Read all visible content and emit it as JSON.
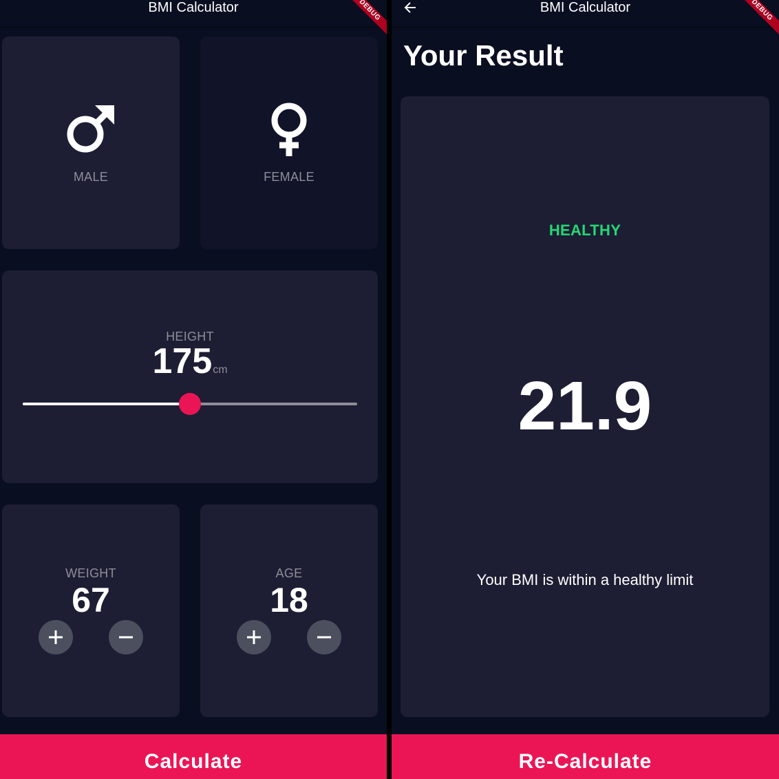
{
  "colors": {
    "background": "#0a0e21",
    "card_active": "#1d1e33",
    "card_inactive": "#111328",
    "label": "#8d8e98",
    "accent": "#eb1555",
    "round_button": "#4c4f5e",
    "healthy": "#24d876"
  },
  "input_screen": {
    "appbar": {
      "title": "BMI Calculator",
      "debug_banner": "DEBUG"
    },
    "gender": {
      "male": {
        "label": "MALE",
        "icon": "male-symbol-icon",
        "selected": true
      },
      "female": {
        "label": "FEMALE",
        "icon": "female-symbol-icon",
        "selected": false
      }
    },
    "height": {
      "label": "HEIGHT",
      "value": "175",
      "unit": "cm",
      "slider_fraction": 0.5
    },
    "weight": {
      "label": "WEIGHT",
      "value": "67",
      "increment_icon": "plus-icon",
      "decrement_icon": "minus-icon"
    },
    "age": {
      "label": "AGE",
      "value": "18",
      "increment_icon": "plus-icon",
      "decrement_icon": "minus-icon"
    },
    "bottom_button": {
      "label": "Calculate"
    }
  },
  "result_screen": {
    "appbar": {
      "title": "BMI Calculator",
      "debug_banner": "DEBUG",
      "back_icon": "arrow-back-icon"
    },
    "title": "Your Result",
    "status": "HEALTHY",
    "bmi": "21.9",
    "message": "Your BMI is within a healthy limit",
    "bottom_button": {
      "label": "Re-Calculate"
    }
  }
}
